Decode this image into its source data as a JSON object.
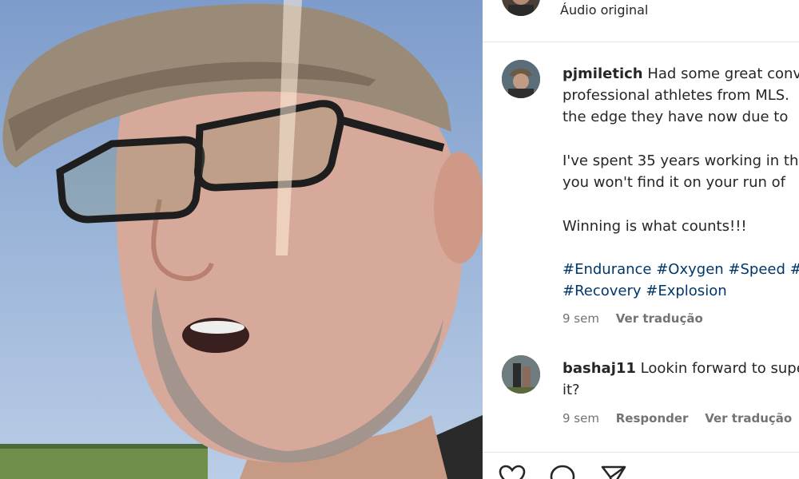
{
  "header": {
    "audio_label": "Áudio original"
  },
  "comments": [
    {
      "username": "pjmiletich",
      "lines": [
        "Had some great conv",
        "professional athletes from MLS.",
        "the edge they have now due to"
      ],
      "paragraph2": [
        "I've spent 35 years working in th",
        "you won't find it on your run of"
      ],
      "paragraph3": "Winning is what counts!!!",
      "hashtags_line1": "#Endurance #Oxygen #Speed #",
      "hashtags_line2": "#Recovery #Explosion",
      "time": "9 sem",
      "translate": "Ver tradução"
    },
    {
      "username": "bashaj11",
      "text_line1": "Lookin forward to supe",
      "text_line2": "it?",
      "time": "9 sem",
      "reply": "Responder",
      "translate": "Ver tradução"
    }
  ],
  "actions": {
    "like_icon": "heart-icon",
    "comment_icon": "comment-icon",
    "share_icon": "share-icon"
  }
}
